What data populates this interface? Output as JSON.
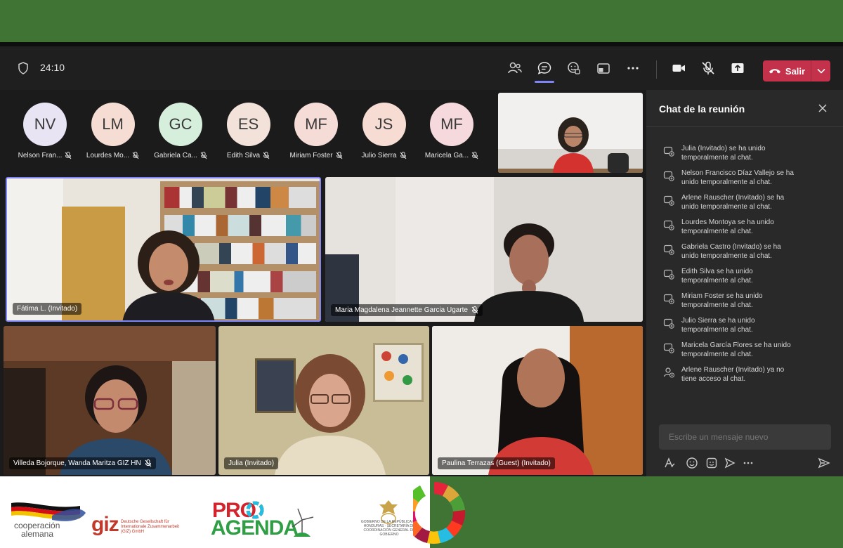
{
  "toolbar": {
    "timer": "24:10",
    "leave_label": "Salir"
  },
  "participants_strip": [
    {
      "initials": "NV",
      "name": "Nelson Fran...",
      "bg": "#e8e4f4"
    },
    {
      "initials": "LM",
      "name": "Lourdes Mo...",
      "bg": "#f6ddd3"
    },
    {
      "initials": "GC",
      "name": "Gabriela Ca...",
      "bg": "#d6eedc"
    },
    {
      "initials": "ES",
      "name": "Edith Silva",
      "bg": "#f3e2d9"
    },
    {
      "initials": "MF",
      "name": "Miriam Foster",
      "bg": "#f6dcd6"
    },
    {
      "initials": "JS",
      "name": "Julio Sierra",
      "bg": "#f6dcd3"
    },
    {
      "initials": "MF",
      "name": "Maricela Ga...",
      "bg": "#f6d9dd"
    }
  ],
  "video_tiles": {
    "fatima": "Fátima L. (Invitado)",
    "maria": "Maria Magdalena Jeannette Garcia Ugarte",
    "villeda": "Villeda Bojorque, Wanda Maritza GIZ HN",
    "julia": "Julia (Invitado)",
    "paulina": "Paulina Terrazas (Guest) (Invitado)"
  },
  "chat": {
    "title": "Chat de la reunión",
    "input_placeholder": "Escribe un mensaje nuevo",
    "messages": [
      "Julia (Invitado) se ha unido temporalmente al chat.",
      "Nelson Francisco Díaz Vallejo se ha unido temporalmente al chat.",
      "Arlene Rauscher (Invitado) se ha unido temporalmente al chat.",
      "Lourdes Montoya se ha unido temporalmente al chat.",
      "Gabriela Castro (Invitado) se ha unido temporalmente al chat.",
      "Edith Silva se ha unido temporalmente al chat.",
      "Miriam Foster se ha unido temporalmente al chat.",
      "Julio Sierra se ha unido temporalmente al chat.",
      "Maricela García Flores se ha unido temporalmente al chat.",
      "Arlene Rauscher (Invitado) ya no tiene acceso al chat."
    ]
  },
  "footer": {
    "coop_line1": "cooperación",
    "coop_line2": "alemana",
    "giz": "giz",
    "giz_sub": "Deutsche Gesellschaft für Internationale Zusammenarbeit (GIZ) GmbH",
    "pro": "PRO",
    "agenda": "AGENDA",
    "hn_text": "GOBIERNO DE LA REPÚBLICA DE HONDURAS · SECRETARÍA DE COORDINACIÓN GENERAL DE GOBIERNO"
  },
  "colors": {
    "brand_green": "#3f7434",
    "teams_bg": "#1f1f1f",
    "leave_red": "#c4314b",
    "accent": "#7f85f5"
  }
}
